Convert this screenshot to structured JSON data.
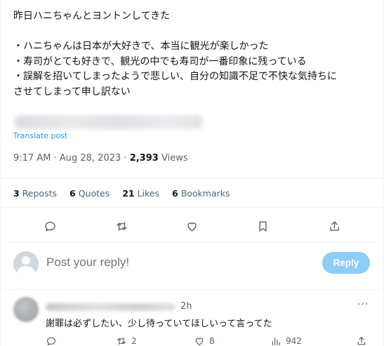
{
  "tweet": {
    "lines": [
      "昨日ハニちゃんとヨントンしてきた",
      "",
      "・ハニちゃんは日本が大好きで、本当に観光が楽しかった",
      "・寿司がとても好きで、観光の中でも寿司が一番印象に残っている",
      "・誤解を招いてしまったようで悲しい、自分の知識不足で不快な気持ちに",
      "させてしまって申し訳ない"
    ],
    "translate_label": "Translate post",
    "time": "9:17 AM",
    "date": "Aug 28, 2023",
    "views_count": "2,393",
    "views_label": "Views",
    "separator": "·"
  },
  "stats": {
    "reposts_count": "3",
    "reposts_label": "Reposts",
    "quotes_count": "6",
    "quotes_label": "Quotes",
    "likes_count": "21",
    "likes_label": "Likes",
    "bookmarks_count": "6",
    "bookmarks_label": "Bookmarks"
  },
  "actions": {
    "icons": [
      "reply-icon",
      "repost-icon",
      "like-icon",
      "bookmark-icon",
      "share-icon"
    ]
  },
  "compose": {
    "placeholder": "Post your reply!",
    "button_label": "Reply",
    "button_color": "#8ecdf7"
  },
  "reply": {
    "time": "2h",
    "more": "···",
    "text": "謝罪は必ずしたい、少し待っていてほしいって言ってた",
    "replies_count": "",
    "reposts_count": "2",
    "likes_count": "8",
    "views_count": "942"
  },
  "colors": {
    "accent": "#1d9bf0",
    "muted": "#536471",
    "text": "#0f1419",
    "divider": "#eff3f4"
  }
}
